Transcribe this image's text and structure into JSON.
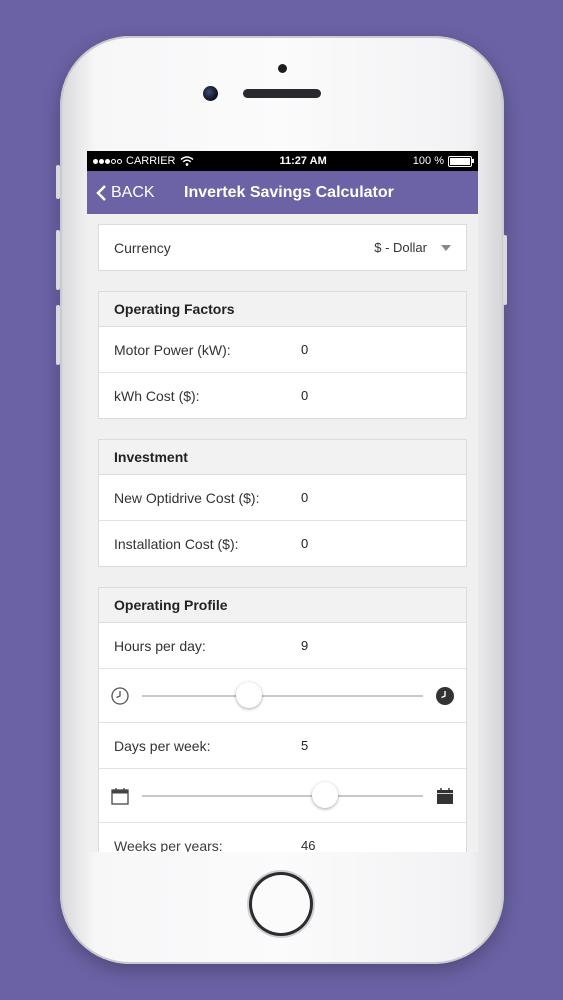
{
  "status": {
    "carrier": "CARRIER",
    "time": "11:27 AM",
    "battery": "100 %"
  },
  "nav": {
    "back_label": "BACK",
    "title": "Invertek Savings Calculator",
    "accent": "#6b63a6"
  },
  "currency": {
    "label": "Currency",
    "selected": "$ - Dollar"
  },
  "operating_factors": {
    "title": "Operating Factors",
    "motor_power_label": "Motor Power (kW):",
    "motor_power_value": "0",
    "kwh_cost_label": "kWh Cost ($):",
    "kwh_cost_value": "0"
  },
  "investment": {
    "title": "Investment",
    "optidrive_label": "New Optidrive Cost ($):",
    "optidrive_value": "0",
    "installation_label": "Installation Cost ($):",
    "installation_value": "0"
  },
  "operating_profile": {
    "title": "Operating Profile",
    "hours_label": "Hours per day:",
    "hours_value": "9",
    "hours_slider_fraction": 0.38,
    "days_label": "Days per week:",
    "days_value": "5",
    "days_slider_fraction": 0.65,
    "weeks_label": "Weeks per years:",
    "weeks_value": "46"
  },
  "icons": {
    "hours_min": "clock-outline-icon",
    "hours_max": "clock-filled-icon",
    "days_min": "calendar-outline-icon",
    "days_max": "calendar-filled-icon"
  }
}
